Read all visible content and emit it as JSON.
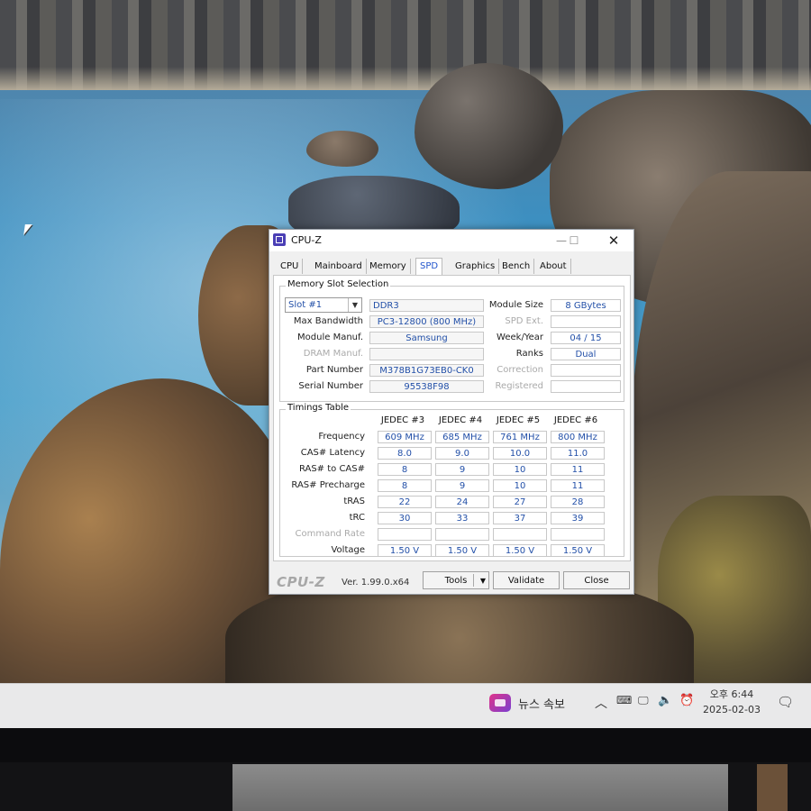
{
  "window": {
    "title": "CPU-Z",
    "tabs": [
      "CPU",
      "Mainboard",
      "Memory",
      "SPD",
      "Graphics",
      "Bench",
      "About"
    ],
    "active_tab": "SPD"
  },
  "slot_selection": {
    "label": "Memory Slot Selection",
    "slot": "Slot #1",
    "type": "DDR3",
    "module_size_label": "Module Size",
    "module_size": "8 GBytes",
    "max_bandwidth_label": "Max Bandwidth",
    "max_bandwidth": "PC3-12800 (800 MHz)",
    "spd_ext_label": "SPD Ext.",
    "spd_ext": "",
    "manuf_label": "Module Manuf.",
    "manuf": "Samsung",
    "week_year_label": "Week/Year",
    "week_year": "04 / 15",
    "dram_manuf_label": "DRAM Manuf.",
    "dram_manuf": "",
    "ranks_label": "Ranks",
    "ranks": "Dual",
    "part_number_label": "Part Number",
    "part_number": "M378B1G73EB0-CK0",
    "correction_label": "Correction",
    "correction": "",
    "serial_label": "Serial Number",
    "serial": "95538F98",
    "registered_label": "Registered",
    "registered": ""
  },
  "timings": {
    "label": "Timings Table",
    "columns": [
      "JEDEC #3",
      "JEDEC #4",
      "JEDEC #5",
      "JEDEC #6"
    ],
    "rows": [
      {
        "label": "Frequency",
        "values": [
          "609 MHz",
          "685 MHz",
          "761 MHz",
          "800 MHz"
        ]
      },
      {
        "label": "CAS# Latency",
        "values": [
          "8.0",
          "9.0",
          "10.0",
          "11.0"
        ]
      },
      {
        "label": "RAS# to CAS#",
        "values": [
          "8",
          "9",
          "10",
          "11"
        ]
      },
      {
        "label": "RAS# Precharge",
        "values": [
          "8",
          "9",
          "10",
          "11"
        ]
      },
      {
        "label": "tRAS",
        "values": [
          "22",
          "24",
          "27",
          "28"
        ]
      },
      {
        "label": "tRC",
        "values": [
          "30",
          "33",
          "37",
          "39"
        ]
      },
      {
        "label": "Command Rate",
        "values": [
          "",
          "",
          "",
          ""
        ]
      },
      {
        "label": "Voltage",
        "values": [
          "1.50 V",
          "1.50 V",
          "1.50 V",
          "1.50 V"
        ]
      }
    ]
  },
  "footer": {
    "logo": "CPU-Z",
    "version": "Ver. 1.99.0.x64",
    "tools_label": "Tools",
    "validate_label": "Validate",
    "close_label": "Close"
  },
  "taskbar": {
    "news_label": "뉴스 속보",
    "tray_icons": [
      "chevron-up-icon",
      "keyboard-icon",
      "network-icon",
      "speaker-icon",
      "alarm-icon"
    ],
    "clock_time": "오후 6:44",
    "clock_date": "2025-02-03"
  },
  "colors": {
    "value_text": "#2350a8",
    "active_tab": "#2255cc",
    "news_icon": "#c0338a"
  }
}
